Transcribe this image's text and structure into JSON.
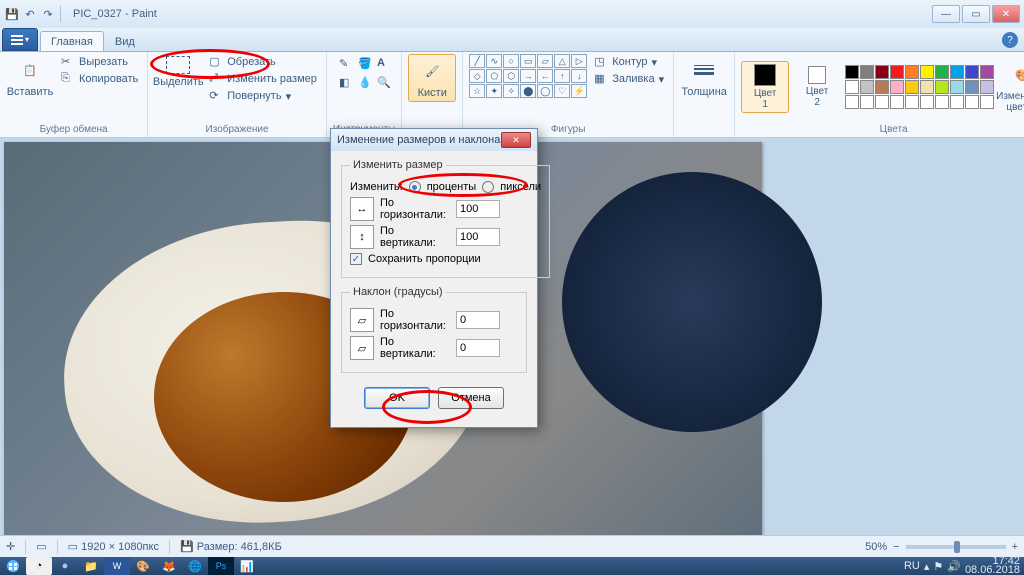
{
  "window": {
    "doc_name": "PIC_0327",
    "app_name": "Paint",
    "title_sep": " -"
  },
  "tabs": {
    "file_dropdown": "▾",
    "main": "Главная",
    "view": "Вид"
  },
  "ribbon": {
    "clipboard": {
      "paste": "Вставить",
      "cut": "Вырезать",
      "copy": "Копировать",
      "group": "Буфер обмена"
    },
    "image": {
      "select": "Выделить",
      "crop": "Обрезать",
      "resize": "Изменить размер",
      "rotate": "Повернуть",
      "group": "Изображение"
    },
    "tools": {
      "group": "Инструменты"
    },
    "brushes": {
      "label": "Кисти"
    },
    "shapes": {
      "outline": "Контур",
      "fill": "Заливка",
      "group": "Фигуры"
    },
    "size": {
      "thickness": "Толщина"
    },
    "colors": {
      "color1": "Цвет\n1",
      "color2": "Цвет\n2",
      "edit": "Изменение\nцветов",
      "group": "Цвета"
    }
  },
  "palette": [
    "#000000",
    "#7f7f7f",
    "#880015",
    "#ed1c24",
    "#ff7f27",
    "#fff200",
    "#22b14c",
    "#00a2e8",
    "#3f48cc",
    "#a349a4",
    "#ffffff",
    "#c3c3c3",
    "#b97a57",
    "#ffaec9",
    "#ffc90e",
    "#efe4b0",
    "#b5e61d",
    "#99d9ea",
    "#7092be",
    "#c8bfe7"
  ],
  "dialog": {
    "title": "Изменение размеров и наклона",
    "resize_group": "Изменить размер",
    "by_label": "Изменить:",
    "percent": "проценты",
    "pixels": "пиксели",
    "horiz": "По\nгоризонтали:",
    "vert": "По вертикали:",
    "h_val": "100",
    "v_val": "100",
    "keep_ratio": "Сохранить пропорции",
    "skew_group": "Наклон (градусы)",
    "skew_h": "0",
    "skew_v": "0",
    "ok": "OK",
    "cancel": "Отмена"
  },
  "status": {
    "coords_icon": "✛",
    "dims": "1920 × 1080пкс",
    "size": "Размер: 461,8КБ",
    "zoom": "50%",
    "minus": "−",
    "plus": "+"
  },
  "taskbar": {
    "lang": "RU",
    "time": "17:42",
    "date": "08.06.2018"
  }
}
